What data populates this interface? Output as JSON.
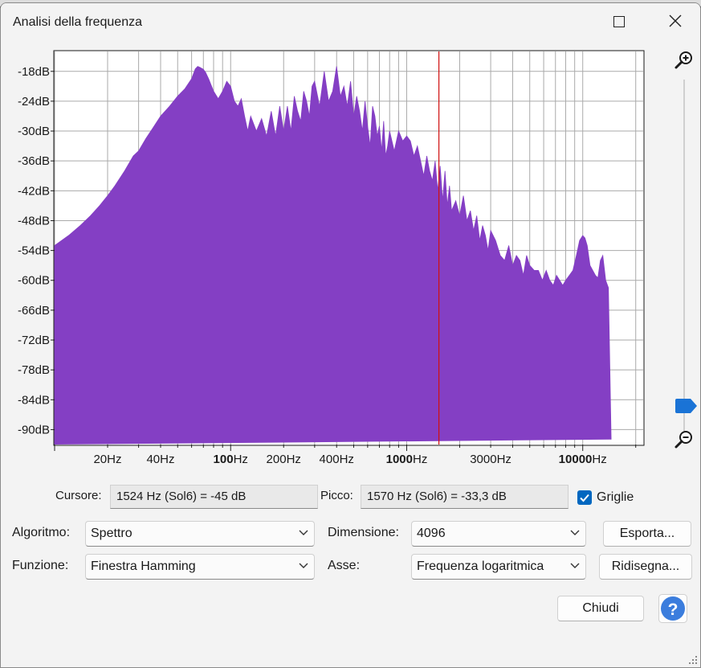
{
  "window": {
    "title": "Analisi della frequenza"
  },
  "chart_data": {
    "type": "area",
    "x_scale": "log",
    "xlim": [
      10,
      22050
    ],
    "ylim": [
      -93,
      -14
    ],
    "ytick_labels": [
      "-18dB",
      "-24dB",
      "-30dB",
      "-36dB",
      "-42dB",
      "-48dB",
      "-54dB",
      "-60dB",
      "-66dB",
      "-72dB",
      "-78dB",
      "-84dB",
      "-90dB"
    ],
    "ytick_values": [
      -18,
      -24,
      -30,
      -36,
      -42,
      -48,
      -54,
      -60,
      -66,
      -72,
      -78,
      -84,
      -90
    ],
    "xtick_labels": [
      {
        "num": "20",
        "unit": "Hz",
        "value": 20
      },
      {
        "num": "40",
        "unit": "Hz",
        "value": 40
      },
      {
        "num": "100",
        "unit": "Hz",
        "value": 100
      },
      {
        "num": "200",
        "unit": "Hz",
        "value": 200
      },
      {
        "num": "400",
        "unit": "Hz",
        "value": 400
      },
      {
        "num": "1000",
        "unit": "Hz",
        "value": 1000
      },
      {
        "num": "3000",
        "unit": "Hz",
        "value": 3000
      },
      {
        "num": "10000",
        "unit": "Hz",
        "value": 10000
      }
    ],
    "grid": true,
    "fill_color": "#843fc4",
    "cursor_freq_hz": 1524,
    "cursor_color": "#d01010",
    "x": [
      10,
      12,
      14,
      16,
      18,
      20,
      22,
      25,
      28,
      30,
      33,
      36,
      40,
      45,
      50,
      55,
      60,
      63,
      65,
      67,
      70,
      72,
      75,
      80,
      85,
      90,
      95,
      100,
      105,
      110,
      115,
      120,
      125,
      130,
      140,
      150,
      160,
      170,
      180,
      190,
      200,
      210,
      220,
      230,
      240,
      250,
      260,
      270,
      280,
      290,
      300,
      320,
      340,
      360,
      380,
      400,
      420,
      440,
      460,
      480,
      500,
      520,
      540,
      560,
      580,
      600,
      620,
      640,
      660,
      680,
      700,
      720,
      740,
      760,
      780,
      800,
      850,
      900,
      950,
      1000,
      1050,
      1100,
      1150,
      1200,
      1250,
      1300,
      1350,
      1400,
      1450,
      1500,
      1550,
      1600,
      1650,
      1700,
      1750,
      1800,
      1900,
      2000,
      2100,
      2200,
      2300,
      2400,
      2500,
      2600,
      2700,
      2800,
      2900,
      3000,
      3200,
      3400,
      3600,
      3800,
      4000,
      4200,
      4400,
      4600,
      4800,
      5000,
      5300,
      5600,
      5900,
      6200,
      6500,
      6800,
      7100,
      7400,
      7700,
      8000,
      8400,
      8800,
      9200,
      9600,
      10000,
      10300,
      10600,
      11000,
      11400,
      11800,
      12200,
      12600,
      13000,
      13500,
      14000,
      14500,
      15000,
      16000
    ],
    "y": [
      -53,
      -51,
      -49,
      -47,
      -45,
      -43,
      -41,
      -38,
      -35,
      -34,
      -31.5,
      -29.5,
      -27,
      -25,
      -23,
      -21.5,
      -19.5,
      -17.5,
      -17,
      -17.2,
      -17.6,
      -18.2,
      -19.5,
      -22,
      -23.5,
      -22,
      -20,
      -21,
      -24,
      -25,
      -23.5,
      -27,
      -30,
      -27,
      -30,
      -27.5,
      -31,
      -26,
      -31,
      -25,
      -30,
      -25,
      -30,
      -23,
      -26,
      -28,
      -22,
      -24,
      -27,
      -21,
      -20,
      -25,
      -18,
      -24,
      -22,
      -17,
      -23,
      -21,
      -25,
      -20,
      -27,
      -23,
      -26,
      -30,
      -24,
      -29,
      -33,
      -25,
      -27,
      -31,
      -29,
      -34,
      -28,
      -35,
      -33,
      -30,
      -34,
      -30,
      -32,
      -31,
      -32,
      -35,
      -33,
      -36,
      -39,
      -35,
      -38,
      -40,
      -36,
      -42,
      -37,
      -44,
      -38,
      -45,
      -41,
      -46,
      -44,
      -47,
      -43,
      -48,
      -46,
      -50,
      -47,
      -52,
      -49,
      -51,
      -54,
      -50,
      -52,
      -55,
      -56,
      -53,
      -57,
      -55,
      -56,
      -59,
      -55,
      -57,
      -58,
      -58,
      -60,
      -58,
      -60,
      -61,
      -59,
      -60,
      -61,
      -60,
      -59,
      -58,
      -55,
      -52,
      -51,
      -51.5,
      -53,
      -57,
      -58,
      -59,
      -59.5,
      -56,
      -55,
      -60,
      -61.5,
      -92
    ]
  },
  "readouts": {
    "cursor_label": "Cursore:",
    "cursor_value": "1524 Hz (Sol6) = -45 dB",
    "peak_label": "Picco:",
    "peak_value": "1570 Hz (Sol6) = -33,3 dB",
    "grids_label": "Griglie",
    "grids_checked": true
  },
  "controls": {
    "algorithm_label": "Algoritmo:",
    "algorithm_value": "Spettro",
    "size_label": "Dimensione:",
    "size_value": "4096",
    "function_label": "Funzione:",
    "function_value": "Finestra Hamming",
    "axis_label": "Asse:",
    "axis_value": "Frequenza logaritmica",
    "export_label": "Esporta...",
    "replot_label": "Ridisegna...",
    "close_label": "Chiudi",
    "help_label": "?"
  },
  "colors": {
    "accent": "#0067c0",
    "help": "#3b7ddd",
    "background": "#f3f3f3"
  }
}
